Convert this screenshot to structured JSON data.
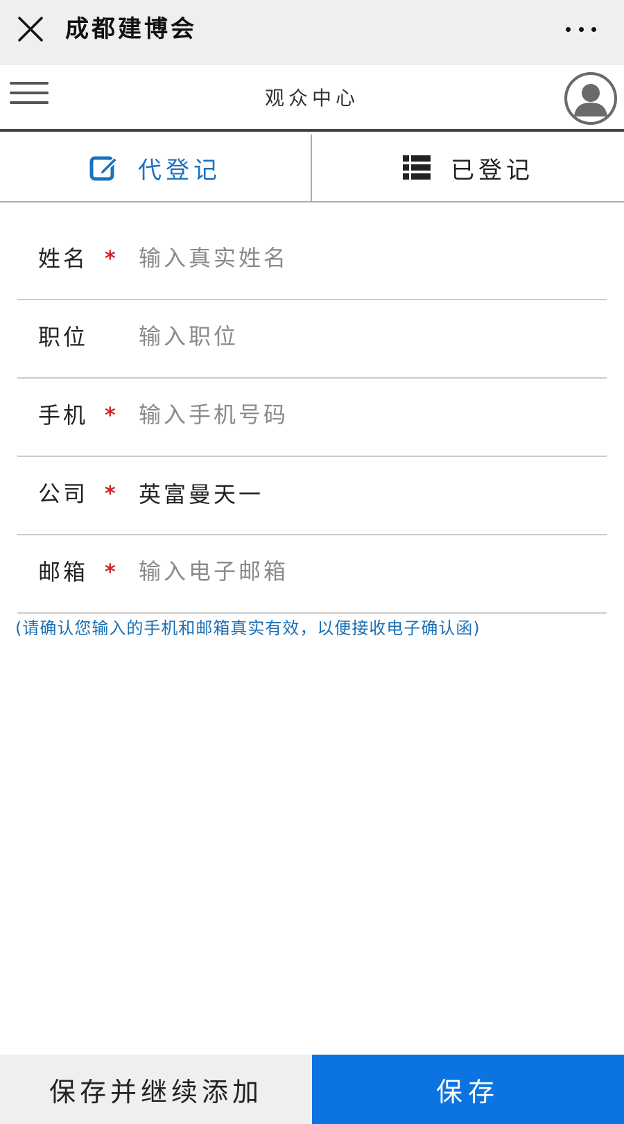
{
  "titlebar": {
    "close_icon": "close-icon",
    "title": "成都建博会",
    "more_icon": "more-icon"
  },
  "header": {
    "menu_icon": "hamburger-menu-icon",
    "page_title": "观众中心",
    "avatar_icon": "user-avatar-icon"
  },
  "tabs": [
    {
      "label": "代登记",
      "icon": "edit-icon",
      "active": true
    },
    {
      "label": "已登记",
      "icon": "list-icon",
      "active": false
    }
  ],
  "form": {
    "fields": [
      {
        "label": "姓名",
        "required": true,
        "required_mark": "*",
        "placeholder": "输入真实姓名",
        "value": ""
      },
      {
        "label": "职位",
        "required": false,
        "required_mark": "",
        "placeholder": "输入职位",
        "value": ""
      },
      {
        "label": "手机",
        "required": true,
        "required_mark": "*",
        "placeholder": "输入手机号码",
        "value": ""
      },
      {
        "label": "公司",
        "required": true,
        "required_mark": "*",
        "placeholder": "",
        "value": "英富曼天一"
      },
      {
        "label": "邮箱",
        "required": true,
        "required_mark": "*",
        "placeholder": "输入电子邮箱",
        "value": ""
      }
    ],
    "hint": "(请确认您输入的手机和邮箱真实有效，以便接收电子确认函)"
  },
  "buttons": {
    "save_and_add": "保存并继续添加",
    "save": "保存"
  },
  "colors": {
    "accent": "#1a72c2",
    "primary_button": "#0b74e0",
    "required": "#d0242a",
    "hint": "#1a6fb5"
  }
}
